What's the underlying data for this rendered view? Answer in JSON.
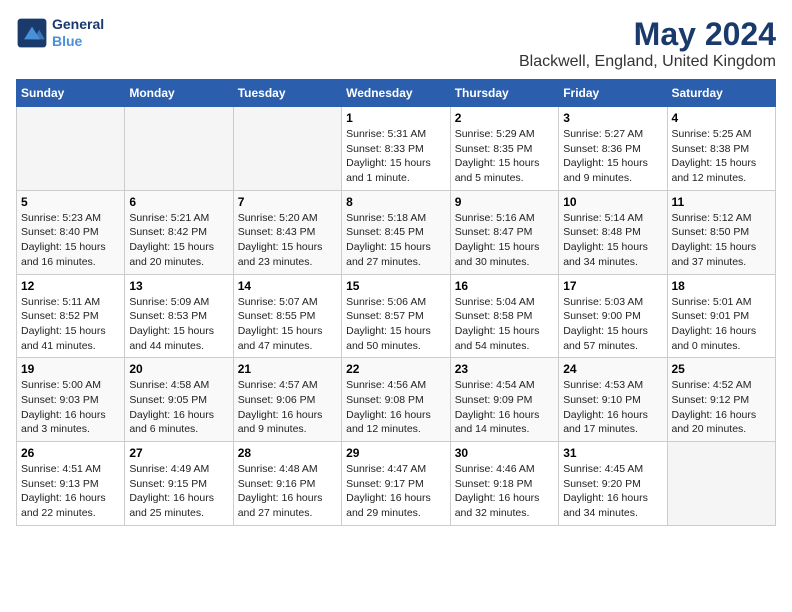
{
  "logo": {
    "line1": "General",
    "line2": "Blue"
  },
  "title": "May 2024",
  "subtitle": "Blackwell, England, United Kingdom",
  "weekdays": [
    "Sunday",
    "Monday",
    "Tuesday",
    "Wednesday",
    "Thursday",
    "Friday",
    "Saturday"
  ],
  "weeks": [
    [
      {
        "day": "",
        "info": ""
      },
      {
        "day": "",
        "info": ""
      },
      {
        "day": "",
        "info": ""
      },
      {
        "day": "1",
        "info": "Sunrise: 5:31 AM\nSunset: 8:33 PM\nDaylight: 15 hours and 1 minute."
      },
      {
        "day": "2",
        "info": "Sunrise: 5:29 AM\nSunset: 8:35 PM\nDaylight: 15 hours and 5 minutes."
      },
      {
        "day": "3",
        "info": "Sunrise: 5:27 AM\nSunset: 8:36 PM\nDaylight: 15 hours and 9 minutes."
      },
      {
        "day": "4",
        "info": "Sunrise: 5:25 AM\nSunset: 8:38 PM\nDaylight: 15 hours and 12 minutes."
      }
    ],
    [
      {
        "day": "5",
        "info": "Sunrise: 5:23 AM\nSunset: 8:40 PM\nDaylight: 15 hours and 16 minutes."
      },
      {
        "day": "6",
        "info": "Sunrise: 5:21 AM\nSunset: 8:42 PM\nDaylight: 15 hours and 20 minutes."
      },
      {
        "day": "7",
        "info": "Sunrise: 5:20 AM\nSunset: 8:43 PM\nDaylight: 15 hours and 23 minutes."
      },
      {
        "day": "8",
        "info": "Sunrise: 5:18 AM\nSunset: 8:45 PM\nDaylight: 15 hours and 27 minutes."
      },
      {
        "day": "9",
        "info": "Sunrise: 5:16 AM\nSunset: 8:47 PM\nDaylight: 15 hours and 30 minutes."
      },
      {
        "day": "10",
        "info": "Sunrise: 5:14 AM\nSunset: 8:48 PM\nDaylight: 15 hours and 34 minutes."
      },
      {
        "day": "11",
        "info": "Sunrise: 5:12 AM\nSunset: 8:50 PM\nDaylight: 15 hours and 37 minutes."
      }
    ],
    [
      {
        "day": "12",
        "info": "Sunrise: 5:11 AM\nSunset: 8:52 PM\nDaylight: 15 hours and 41 minutes."
      },
      {
        "day": "13",
        "info": "Sunrise: 5:09 AM\nSunset: 8:53 PM\nDaylight: 15 hours and 44 minutes."
      },
      {
        "day": "14",
        "info": "Sunrise: 5:07 AM\nSunset: 8:55 PM\nDaylight: 15 hours and 47 minutes."
      },
      {
        "day": "15",
        "info": "Sunrise: 5:06 AM\nSunset: 8:57 PM\nDaylight: 15 hours and 50 minutes."
      },
      {
        "day": "16",
        "info": "Sunrise: 5:04 AM\nSunset: 8:58 PM\nDaylight: 15 hours and 54 minutes."
      },
      {
        "day": "17",
        "info": "Sunrise: 5:03 AM\nSunset: 9:00 PM\nDaylight: 15 hours and 57 minutes."
      },
      {
        "day": "18",
        "info": "Sunrise: 5:01 AM\nSunset: 9:01 PM\nDaylight: 16 hours and 0 minutes."
      }
    ],
    [
      {
        "day": "19",
        "info": "Sunrise: 5:00 AM\nSunset: 9:03 PM\nDaylight: 16 hours and 3 minutes."
      },
      {
        "day": "20",
        "info": "Sunrise: 4:58 AM\nSunset: 9:05 PM\nDaylight: 16 hours and 6 minutes."
      },
      {
        "day": "21",
        "info": "Sunrise: 4:57 AM\nSunset: 9:06 PM\nDaylight: 16 hours and 9 minutes."
      },
      {
        "day": "22",
        "info": "Sunrise: 4:56 AM\nSunset: 9:08 PM\nDaylight: 16 hours and 12 minutes."
      },
      {
        "day": "23",
        "info": "Sunrise: 4:54 AM\nSunset: 9:09 PM\nDaylight: 16 hours and 14 minutes."
      },
      {
        "day": "24",
        "info": "Sunrise: 4:53 AM\nSunset: 9:10 PM\nDaylight: 16 hours and 17 minutes."
      },
      {
        "day": "25",
        "info": "Sunrise: 4:52 AM\nSunset: 9:12 PM\nDaylight: 16 hours and 20 minutes."
      }
    ],
    [
      {
        "day": "26",
        "info": "Sunrise: 4:51 AM\nSunset: 9:13 PM\nDaylight: 16 hours and 22 minutes."
      },
      {
        "day": "27",
        "info": "Sunrise: 4:49 AM\nSunset: 9:15 PM\nDaylight: 16 hours and 25 minutes."
      },
      {
        "day": "28",
        "info": "Sunrise: 4:48 AM\nSunset: 9:16 PM\nDaylight: 16 hours and 27 minutes."
      },
      {
        "day": "29",
        "info": "Sunrise: 4:47 AM\nSunset: 9:17 PM\nDaylight: 16 hours and 29 minutes."
      },
      {
        "day": "30",
        "info": "Sunrise: 4:46 AM\nSunset: 9:18 PM\nDaylight: 16 hours and 32 minutes."
      },
      {
        "day": "31",
        "info": "Sunrise: 4:45 AM\nSunset: 9:20 PM\nDaylight: 16 hours and 34 minutes."
      },
      {
        "day": "",
        "info": ""
      }
    ]
  ]
}
